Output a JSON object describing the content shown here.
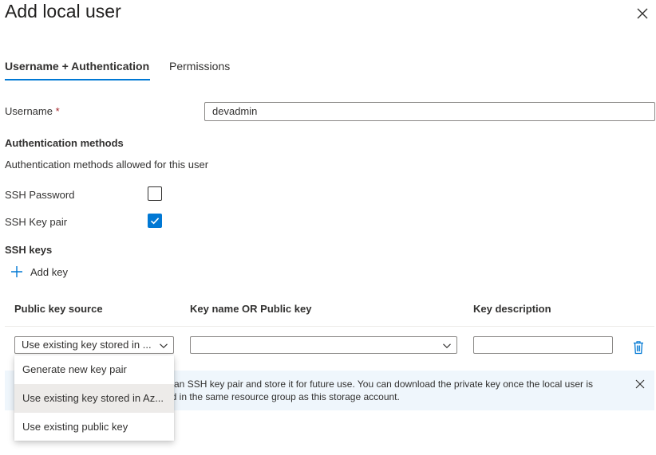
{
  "panel": {
    "title": "Add local user"
  },
  "tabs": [
    {
      "label": "Username + Authentication",
      "active": true
    },
    {
      "label": "Permissions",
      "active": false
    }
  ],
  "username": {
    "label": "Username",
    "required_mark": "*",
    "value": "devadmin"
  },
  "auth": {
    "heading": "Authentication methods",
    "description": "Authentication methods allowed for this user",
    "ssh_password": {
      "label": "SSH Password",
      "checked": false
    },
    "ssh_key_pair": {
      "label": "SSH Key pair",
      "checked": true
    }
  },
  "ssh_keys": {
    "heading": "SSH keys",
    "add_key_label": "Add key",
    "columns": [
      "Public key source",
      "Key name OR Public key",
      "Key description"
    ],
    "row": {
      "source_value": "Use existing key stored in ...",
      "key_value": "",
      "description_value": ""
    }
  },
  "info": {
    "line1": "e an SSH key pair and store it for future use. You can download the private key once the local user is",
    "line2": "ed in the same resource group as this storage account."
  },
  "dropdown_menu": {
    "options": [
      {
        "label": "Generate new key pair",
        "selected": false
      },
      {
        "label": "Use existing key stored in Az...",
        "selected": true
      },
      {
        "label": "Use existing public key",
        "selected": false
      }
    ]
  },
  "colors": {
    "accent": "#0078d4",
    "info_bg": "#eff6fc",
    "delete_icon": "#0078d4",
    "required": "#a4262c"
  }
}
